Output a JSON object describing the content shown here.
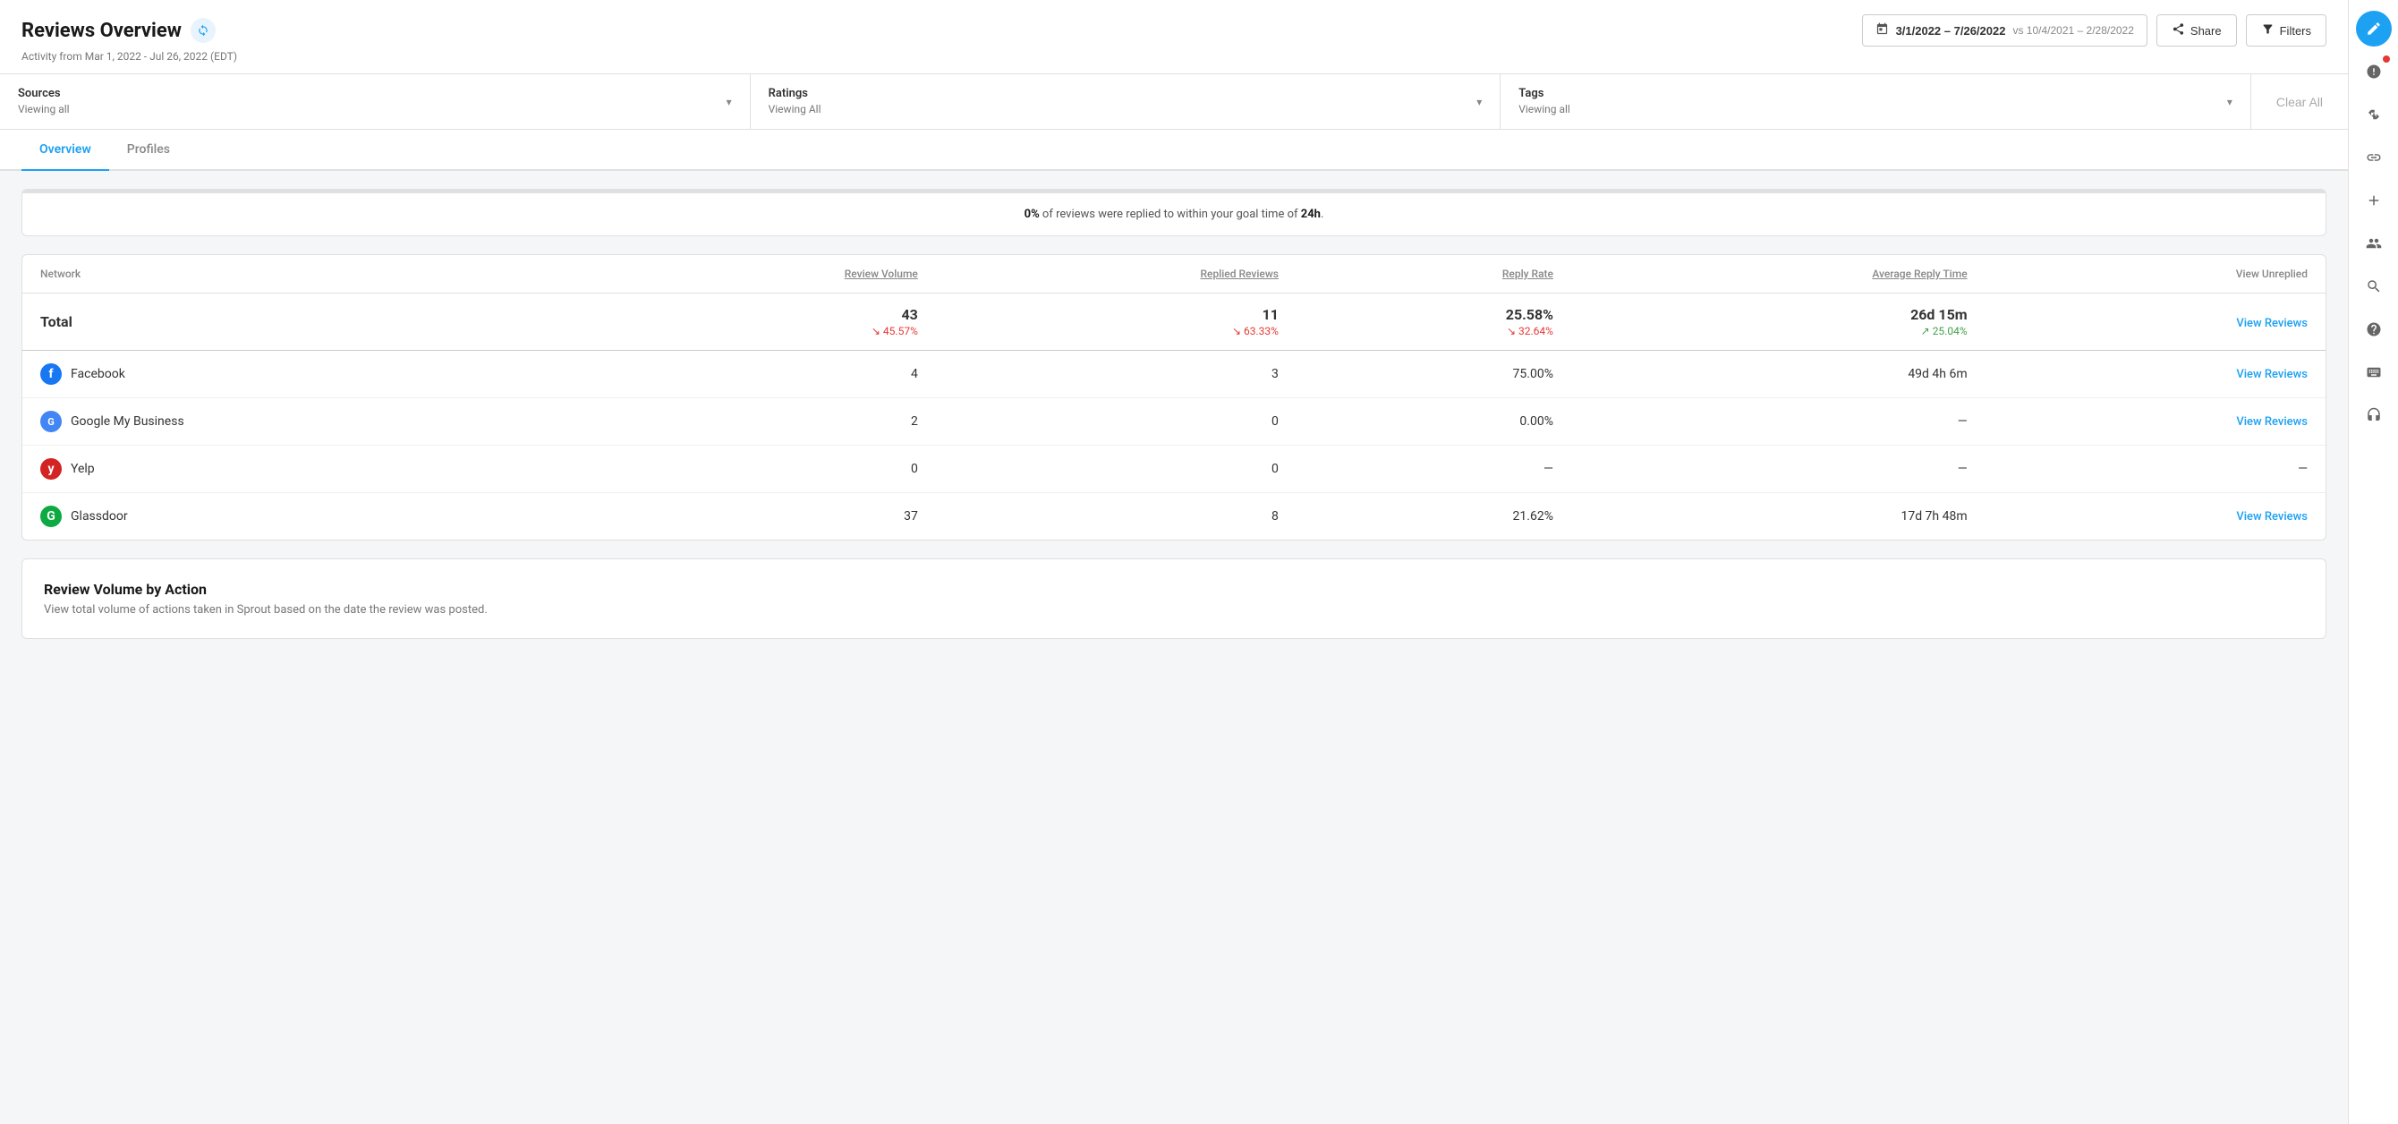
{
  "header": {
    "title": "Reviews Overview",
    "subtitle": "Activity from Mar 1, 2022 - Jul 26, 2022 (EDT)",
    "date_range": "3/1/2022 – 7/26/2022",
    "vs_text": "vs 10/4/2021 – 2/28/2022",
    "share_label": "Share",
    "filters_label": "Filters"
  },
  "filter_bar": {
    "sources_label": "Sources",
    "sources_value": "Viewing all",
    "ratings_label": "Ratings",
    "ratings_value": "Viewing All",
    "tags_label": "Tags",
    "tags_value": "Viewing all",
    "clear_all_label": "Clear All"
  },
  "tabs": [
    {
      "id": "overview",
      "label": "Overview",
      "active": true
    },
    {
      "id": "profiles",
      "label": "Profiles",
      "active": false
    }
  ],
  "reply_goal": {
    "text_prefix": "0%",
    "text_middle": " of reviews were replied to within your goal time of ",
    "text_suffix": "24h",
    "text_end": "."
  },
  "table": {
    "columns": [
      {
        "id": "network",
        "label": "Network",
        "align": "left",
        "underline": false
      },
      {
        "id": "review_volume",
        "label": "Review Volume",
        "align": "right",
        "underline": true
      },
      {
        "id": "replied_reviews",
        "label": "Replied Reviews",
        "align": "right",
        "underline": true
      },
      {
        "id": "reply_rate",
        "label": "Reply Rate",
        "align": "right",
        "underline": true
      },
      {
        "id": "avg_reply_time",
        "label": "Average Reply Time",
        "align": "right",
        "underline": true
      },
      {
        "id": "view_unreplied",
        "label": "View Unreplied",
        "align": "right",
        "underline": false
      }
    ],
    "total_row": {
      "network": "Total",
      "review_volume": "43",
      "review_volume_sub": "↘ 45.57%",
      "replied_reviews": "11",
      "replied_reviews_sub": "↘ 63.33%",
      "reply_rate": "25.58%",
      "reply_rate_sub": "↘ 32.64%",
      "avg_reply_time": "26d 15m",
      "avg_reply_time_sub": "↗ 25.04%",
      "view_link": "View Reviews"
    },
    "rows": [
      {
        "network": "Facebook",
        "network_icon": "fb",
        "review_volume": "4",
        "replied_reviews": "3",
        "reply_rate": "75.00%",
        "avg_reply_time": "49d 4h 6m",
        "view_link": "View Reviews"
      },
      {
        "network": "Google My Business",
        "network_icon": "gmb",
        "review_volume": "2",
        "replied_reviews": "0",
        "reply_rate": "0.00%",
        "avg_reply_time": "—",
        "view_link": "View Reviews"
      },
      {
        "network": "Yelp",
        "network_icon": "yelp",
        "review_volume": "0",
        "replied_reviews": "0",
        "reply_rate": "—",
        "avg_reply_time": "—",
        "view_link": "—"
      },
      {
        "network": "Glassdoor",
        "network_icon": "glassdoor",
        "review_volume": "37",
        "replied_reviews": "8",
        "reply_rate": "21.62%",
        "avg_reply_time": "17d 7h 48m",
        "view_link": "View Reviews"
      }
    ]
  },
  "review_volume_section": {
    "title": "Review Volume by Action",
    "subtitle": "View total volume of actions taken in Sprout based on the date the review was posted."
  },
  "sidebar": {
    "icons": [
      {
        "id": "edit",
        "symbol": "✎",
        "active": true,
        "badge": false
      },
      {
        "id": "alert",
        "symbol": "⚠",
        "active": false,
        "badge": true
      },
      {
        "id": "connect",
        "symbol": "⚡",
        "active": false,
        "badge": false
      },
      {
        "id": "link",
        "symbol": "🔗",
        "active": false,
        "badge": false
      },
      {
        "id": "add",
        "symbol": "+",
        "active": false,
        "badge": false
      },
      {
        "id": "people",
        "symbol": "👥",
        "active": false,
        "badge": false
      },
      {
        "id": "search",
        "symbol": "🔍",
        "active": false,
        "badge": false
      },
      {
        "id": "help",
        "symbol": "?",
        "active": false,
        "badge": false
      },
      {
        "id": "keyboard",
        "symbol": "⌨",
        "active": false,
        "badge": false
      },
      {
        "id": "headset",
        "symbol": "🎧",
        "active": false,
        "badge": false
      }
    ]
  },
  "colors": {
    "primary_blue": "#1da1f2",
    "danger_red": "#e53935",
    "success_green": "#43a047"
  }
}
